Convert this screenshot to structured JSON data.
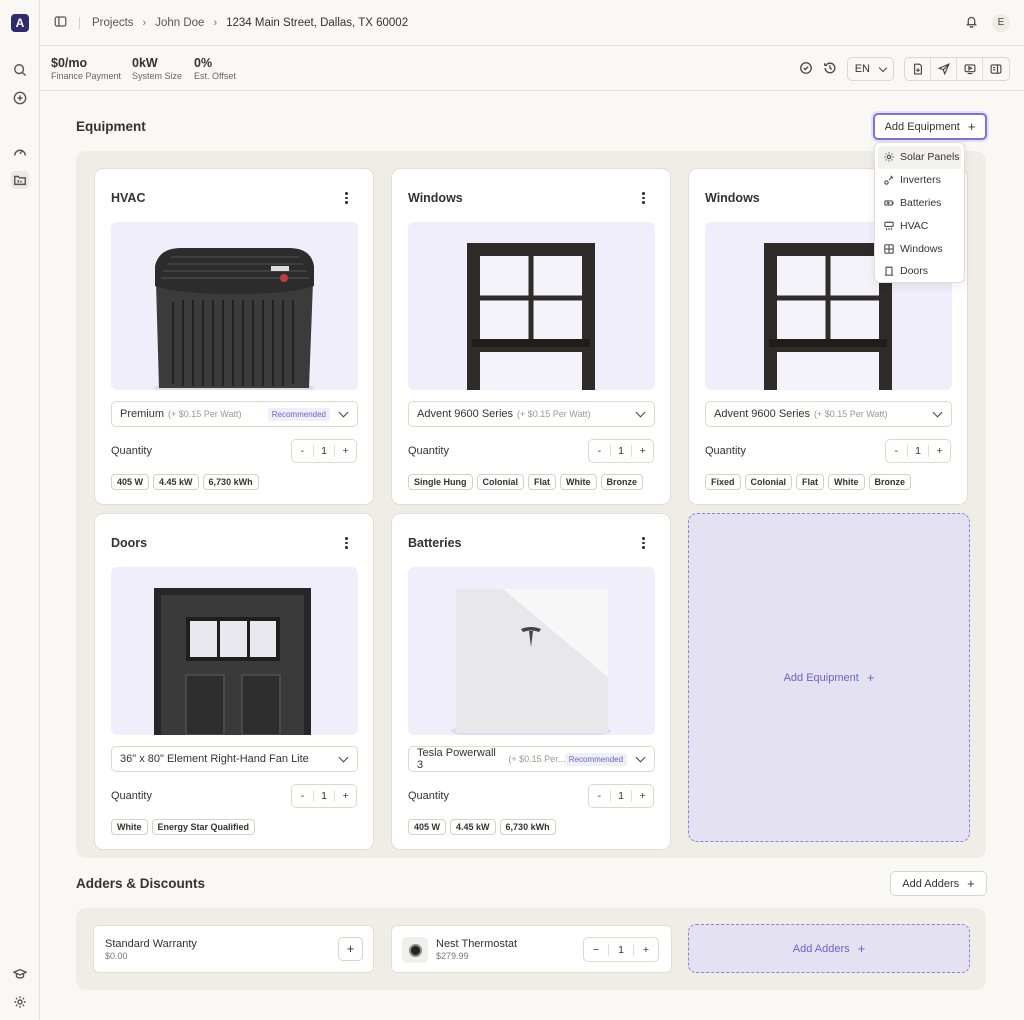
{
  "app": {
    "logo": "A"
  },
  "breadcrumb": [
    "Projects",
    "John Doe",
    "1234 Main Street, Dallas, TX 60002"
  ],
  "user": {
    "initial": "E"
  },
  "stats": [
    {
      "value": "$0/mo",
      "label": "Finance Payment"
    },
    {
      "value": "0kW",
      "label": "System Size"
    },
    {
      "value": "0%",
      "label": "Est. Offset"
    }
  ],
  "language": "EN",
  "equipment": {
    "title": "Equipment",
    "add_label": "Add Equipment",
    "menu": [
      "Solar Panels",
      "Inverters",
      "Batteries",
      "HVAC",
      "Windows",
      "Doors"
    ],
    "cards": [
      {
        "title": "HVAC",
        "product": "Premium",
        "sub": "(+ $0.15 Per Watt)",
        "recommended": "Recommended",
        "quantity_label": "Quantity",
        "quantity": "1",
        "tags": [
          "405 W",
          "4.45 kW",
          "6,730 kWh"
        ]
      },
      {
        "title": "Windows",
        "product": "Advent 9600 Series",
        "sub": "(+ $0.15 Per Watt)",
        "quantity_label": "Quantity",
        "quantity": "1",
        "tags": [
          "Single Hung",
          "Colonial",
          "Flat",
          "White",
          "Bronze"
        ]
      },
      {
        "title": "Windows",
        "product": "Advent 9600 Series",
        "sub": "(+ $0.15 Per Watt)",
        "quantity_label": "Quantity",
        "quantity": "1",
        "tags": [
          "Fixed",
          "Colonial",
          "Flat",
          "White",
          "Bronze"
        ]
      },
      {
        "title": "Doors",
        "product": "36\" x 80\" Element Right-Hand Fan Lite",
        "quantity_label": "Quantity",
        "quantity": "1",
        "tags": [
          "White",
          "Energy Star Qualified"
        ]
      },
      {
        "title": "Batteries",
        "product": "Tesla Powerwall 3",
        "sub": "(+ $0.15 Per...",
        "recommended": "Recommended",
        "quantity_label": "Quantity",
        "quantity": "1",
        "tags": [
          "405 W",
          "4.45 kW",
          "6,730 kWh"
        ]
      }
    ],
    "add_card_label": "Add Equipment"
  },
  "adders": {
    "title": "Adders & Discounts",
    "add_label": "Add Adders",
    "items": [
      {
        "name": "Standard Warranty",
        "price": "$0.00"
      },
      {
        "name": "Nest Thermostat",
        "price": "$279.99",
        "quantity": "1"
      }
    ],
    "add_card_label": "Add Adders"
  },
  "colors": {
    "accent": "#7d75d6",
    "brand": "#2e2a6e",
    "panel": "#f0ede7"
  }
}
